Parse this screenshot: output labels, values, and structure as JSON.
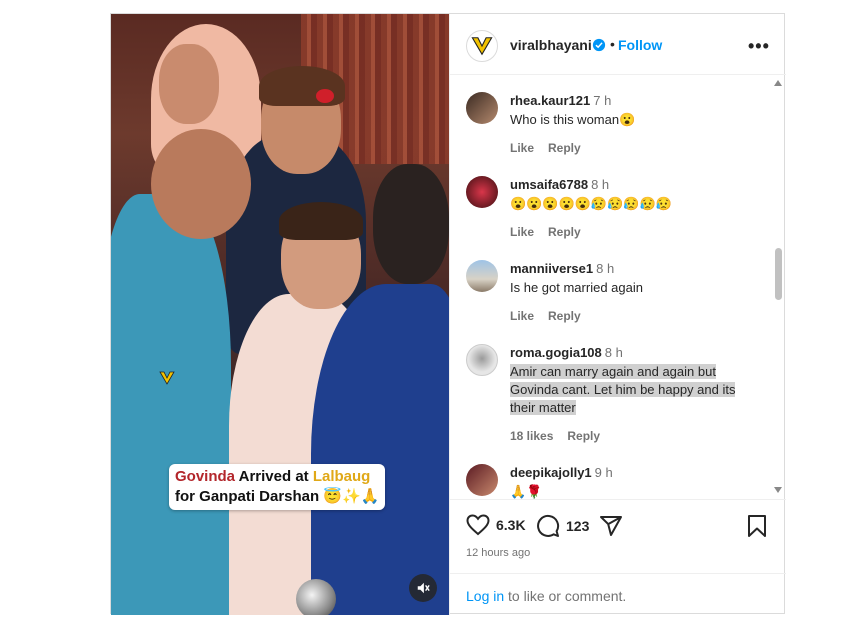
{
  "media": {
    "caption_part1": "Govinda",
    "caption_part2": " Arrived at ",
    "caption_part3": "Lalbaug",
    "caption_line2": "for Ganpati Darshan 😇✨🙏",
    "mute_icon": "speaker-muted-icon",
    "watermark_icon": "viralbhayani-logo-icon"
  },
  "header": {
    "username": "viralbhayani",
    "verified_icon": "verified-badge-icon",
    "dot": "•",
    "follow_label": "Follow",
    "more_label": "•••"
  },
  "comments": [
    {
      "user": "rhea.kaur121",
      "time": "7 h",
      "text": "Who is this woman😮",
      "like_label": "Like",
      "reply_label": "Reply"
    },
    {
      "user": "umsaifa6788",
      "time": "8 h",
      "text": "😮😮😮😮😮😥😥😥😥😥",
      "like_label": "Like",
      "reply_label": "Reply"
    },
    {
      "user": "manniiverse1",
      "time": "8 h",
      "text": "Is he got married again",
      "like_label": "Like",
      "reply_label": "Reply"
    },
    {
      "user": "roma.gogia108",
      "time": "8 h",
      "text": "Amir can marry again and again but Govinda cant. Let him be happy and its their matter",
      "likes_label": "18 likes",
      "reply_label": "Reply"
    },
    {
      "user": "deepikajolly1",
      "time": "9 h",
      "text": "🙏🌹"
    }
  ],
  "footer": {
    "likes_count": "6.3K",
    "comments_count": "123",
    "timestamp": "12 hours ago",
    "login_link": "Log in",
    "login_rest": " to like or comment."
  },
  "colors": {
    "accent": "#0095f6",
    "caption_red": "#b3262b",
    "caption_gold": "#e0a817",
    "text": "#262626",
    "muted": "#737373"
  }
}
